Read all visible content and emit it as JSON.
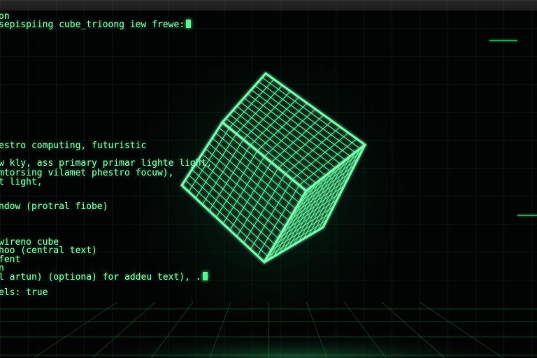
{
  "terminal": {
    "lines": [
      "on",
      "sepispiing cube_trioong iew frewe:",
      "estro computing, futuristic",
      "w kly, ass primary primar lighte light,",
      "mtorsing vilamet phestro focuw),",
      "t light,",
      "ndow (protral fiobe)",
      "wireno cube",
      "hoo (central text)",
      "fent",
      "n",
      "l artun) (optiona) for addeu text), .",
      "els: true"
    ],
    "cursor_visible": true
  },
  "scene": {
    "object": "wireframe cube",
    "glow_color": "#3fe08a",
    "background_color": "#020403"
  }
}
